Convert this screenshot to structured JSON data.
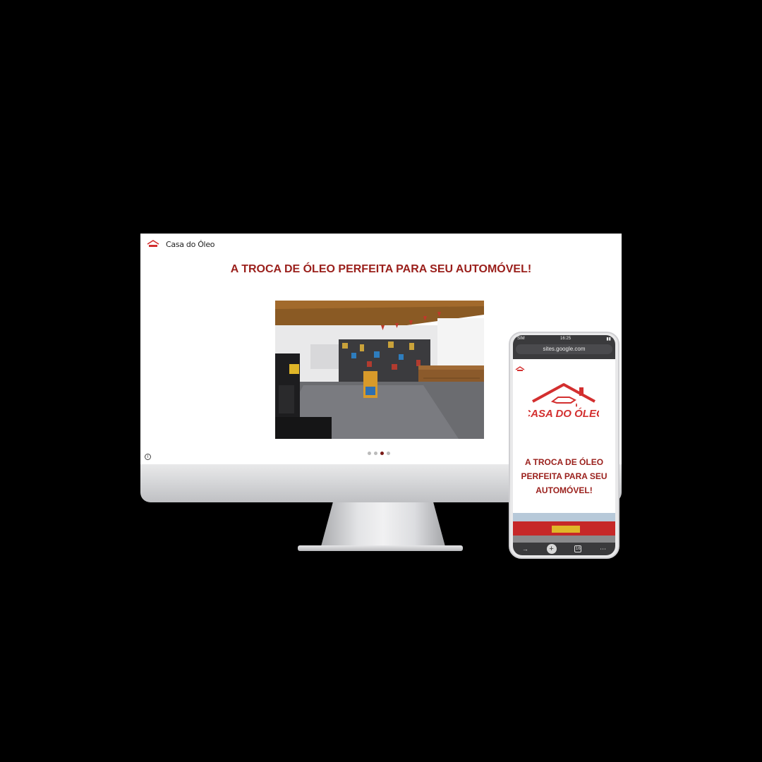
{
  "desktop": {
    "site_name": "Casa do Óleo",
    "hero_title": "A TROCA DE ÓLEO PERFEITA PARA SEU AUTOMÓVEL!",
    "carousel": {
      "count": 4,
      "active_index": 2
    }
  },
  "phone": {
    "status": {
      "carrier": "SIM",
      "time": "16:25"
    },
    "url": "sites.google.com",
    "logo_text": "CASA DO ÓLEO",
    "hero_title": "A TROCA DE ÓLEO PERFEITA PARA SEU AUTOMÓVEL!",
    "tab_count": "16"
  },
  "colors": {
    "brand_red": "#9a1f1b",
    "logo_red": "#d32f2f"
  }
}
